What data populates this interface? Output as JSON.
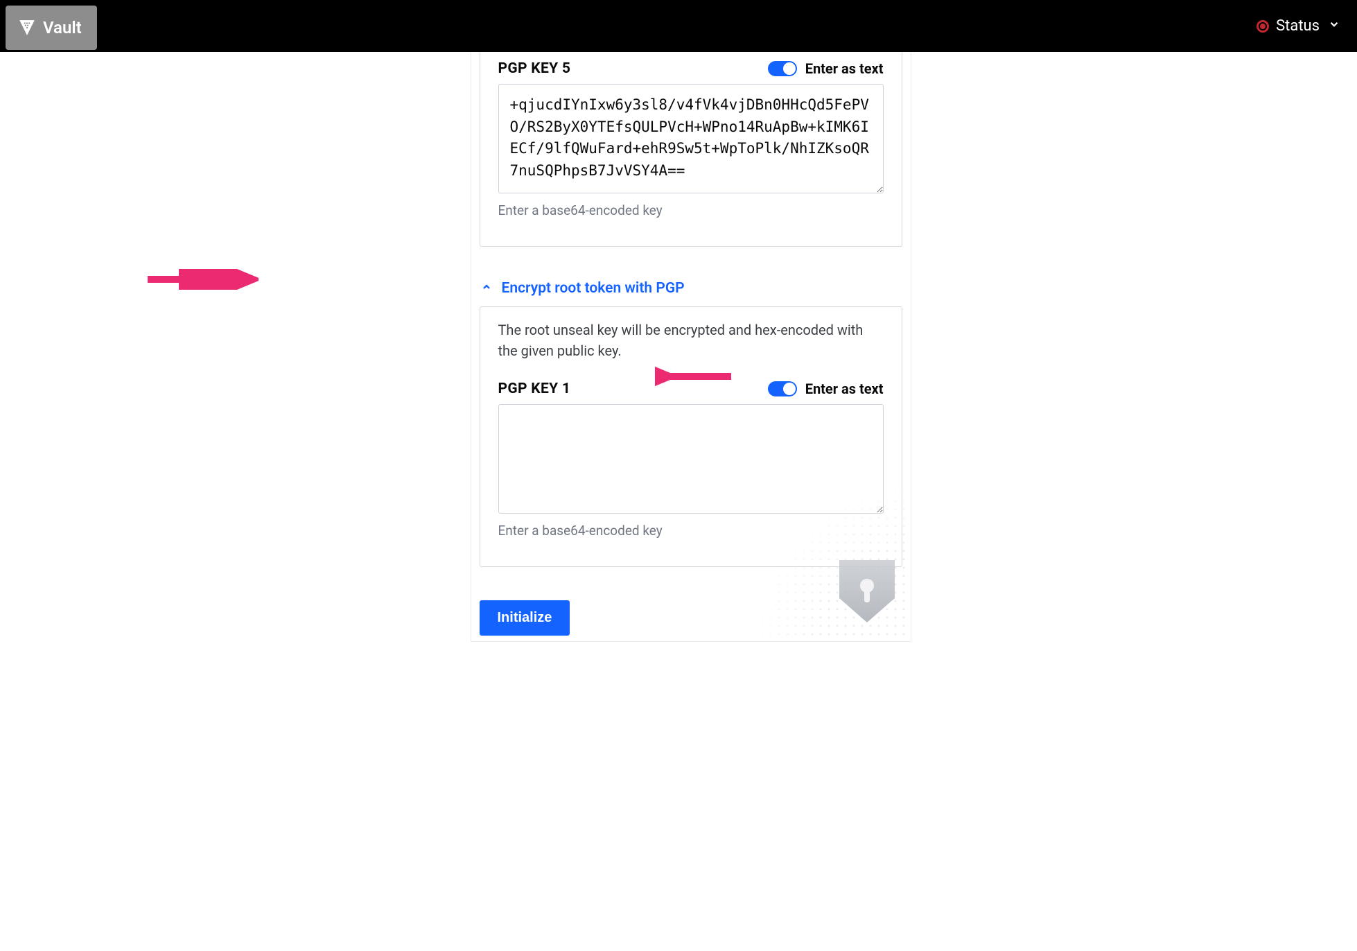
{
  "header": {
    "brand": "Vault",
    "status_label": "Status"
  },
  "pgp5": {
    "label": "PGP KEY 5",
    "toggle_label": "Enter as text",
    "value": "+qjucdIYnIxw6y3sl8/v4fVk4vjDBn0HHcQd5FePVO/RS2ByX0YTEfsQULPVcH+WPno14RuApBw+kIMK6IECf/9lfQWuFard+ehR9Sw5t+WpToPlk/NhIZKsoQR7nuSQPhpsB7JvVSY4A==",
    "hint": "Enter a base64-encoded key"
  },
  "disclosure": {
    "label": "Encrypt root token with PGP"
  },
  "root_section": {
    "description": "The root unseal key will be encrypted and hex-encoded with the given public key.",
    "label": "PGP KEY 1",
    "toggle_label": "Enter as text",
    "value": "",
    "hint": "Enter a base64-encoded key"
  },
  "actions": {
    "initialize": "Initialize"
  }
}
